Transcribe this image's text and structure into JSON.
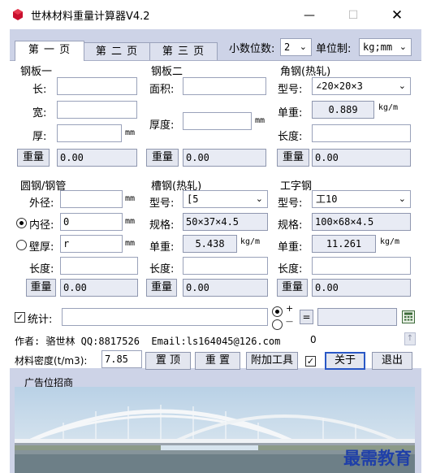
{
  "window": {
    "title": "世林材料重量计算器V4.2",
    "minimize": "—",
    "maximize": "☐",
    "close": "✕"
  },
  "tabs": [
    "第 一 页",
    "第 二 页",
    "第 三 页"
  ],
  "settings": {
    "decimal_label": "小数位数:",
    "decimal_value": "2",
    "unit_label": "单位制:",
    "unit_value": "kg;mm"
  },
  "steel_plate_1": {
    "header": "钢板一",
    "length_label": "长:",
    "width_label": "宽:",
    "thickness_label": "厚:",
    "unit": "mm",
    "weight_button": "重量",
    "weight": "0.00"
  },
  "steel_plate_2": {
    "header": "钢板二",
    "area_label": "面积:",
    "thickness_label": "厚度:",
    "unit": "mm",
    "weight_button": "重量",
    "weight": "0.00"
  },
  "angle_steel": {
    "header": "角钢(热轧)",
    "model_label": "型号:",
    "model_value": "∠20×20×3",
    "unit_weight_label": "单重:",
    "unit_weight": "0.889",
    "unit_weight_unit": "kg/m",
    "length_label": "长度:",
    "weight_button": "重量",
    "weight": "0.00"
  },
  "round_pipe": {
    "header": "圆钢/钢管",
    "outer_label": "外径:",
    "inner_label": "内径:",
    "inner_value": "0",
    "wall_label": "壁厚:",
    "wall_value": "r",
    "length_label": "长度:",
    "unit": "mm",
    "weight_button": "重量",
    "weight": "0.00"
  },
  "channel_steel": {
    "header": "槽钢(热轧)",
    "model_label": "型号:",
    "model_value": "[5",
    "spec_label": "规格:",
    "spec_value": "50×37×4.5",
    "unit_weight_label": "单重:",
    "unit_weight": "5.438",
    "unit_weight_unit": "kg/m",
    "length_label": "长度:",
    "weight_button": "重量",
    "weight": "0.00"
  },
  "i_beam": {
    "header": "工字钢",
    "model_label": "型号:",
    "model_value": "工10",
    "spec_label": "规格:",
    "spec_value": "100×68×4.5",
    "unit_weight_label": "单重:",
    "unit_weight": "11.261",
    "unit_weight_unit": "kg/m",
    "length_label": "长度:",
    "weight_button": "重量",
    "weight": "0.00"
  },
  "stats": {
    "label": "统计:",
    "plus": "+",
    "minus": "—",
    "equals": "="
  },
  "author": {
    "text": "作者: 骆世林 QQ:8817526  Email:ls164045@126.com",
    "count": "0"
  },
  "footer": {
    "density_label": "材料密度(t/m3):",
    "density_value": "7.85",
    "top_button": "置 顶",
    "reset_button": "重 置",
    "tools_button": "附加工具",
    "about_button": "关于",
    "exit_button": "退出"
  },
  "banner": {
    "title": "广告位招商",
    "watermark": "最需教育"
  },
  "colors": {
    "client_bg": "#cdd3e7",
    "panel_bg": "#ffffff",
    "icon_red": "#c8102e",
    "watermark_blue": "#1f3fa8"
  }
}
